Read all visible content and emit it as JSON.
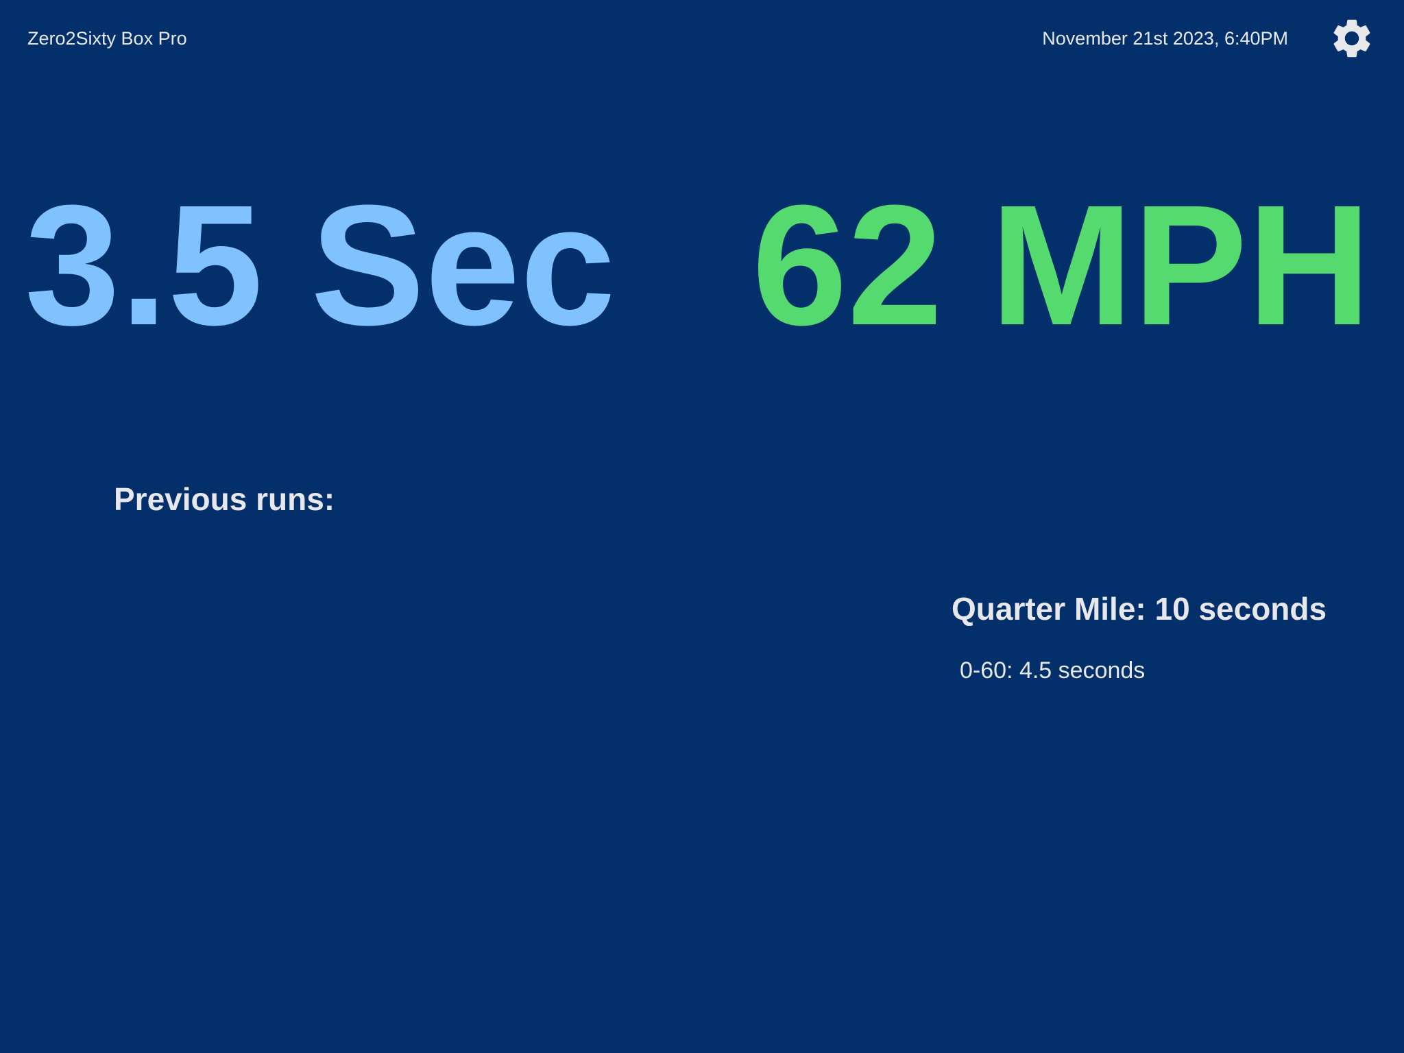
{
  "header": {
    "app_title": "Zero2Sixty Box Pro",
    "datetime": "November 21st 2023, 6:40PM",
    "settings_icon": "gear-icon"
  },
  "readouts": {
    "time": "3.5 Sec",
    "speed": "62 MPH"
  },
  "history": {
    "label": "Previous runs:"
  },
  "stats": {
    "quarter_mile": "Quarter Mile: 10 seconds",
    "zero_to_sixty": "0-60: 4.5 seconds"
  },
  "colors": {
    "background": "#03306a",
    "time_readout": "#7fc2ff",
    "speed_readout": "#54da6e",
    "text": "#e8e8ec"
  }
}
